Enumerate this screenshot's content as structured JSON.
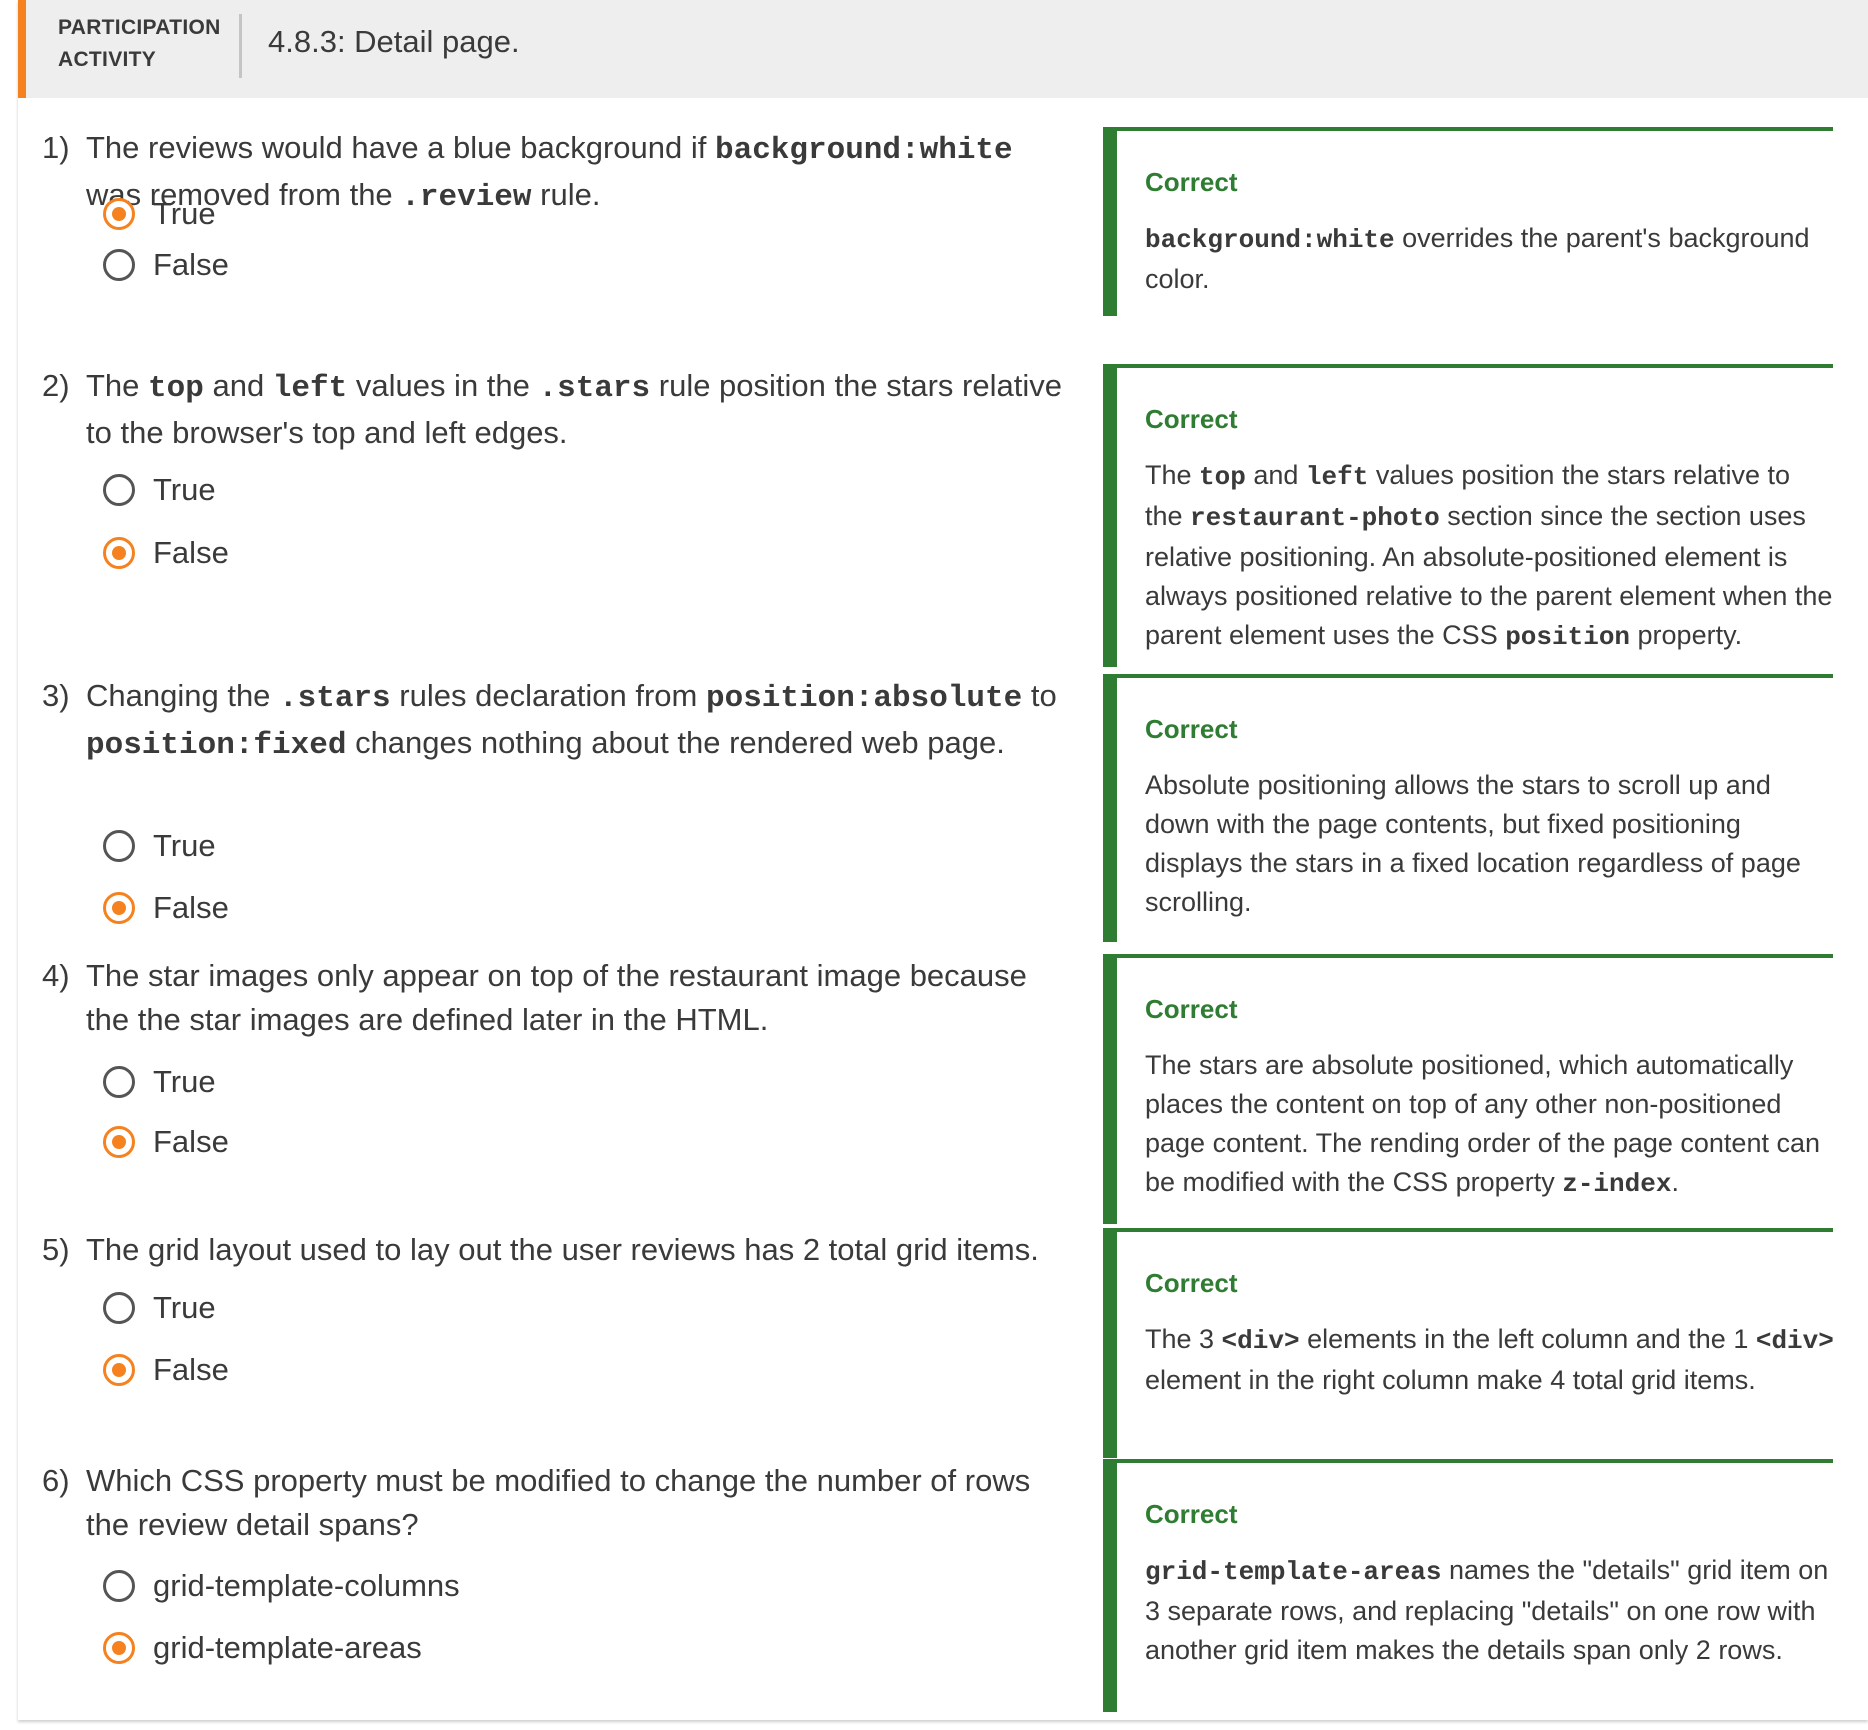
{
  "header": {
    "label_line1": "PARTICIPATION",
    "label_line2": "ACTIVITY",
    "title": "4.8.3: Detail page."
  },
  "questions": [
    {
      "number": "1)",
      "text": [
        {
          "t": "The reviews would have a blue background if "
        },
        {
          "c": "background:white"
        },
        {
          "t": " was removed from the "
        },
        {
          "c": ".review"
        },
        {
          "t": " rule."
        }
      ],
      "options": [
        {
          "label": "True",
          "selected": true
        },
        {
          "label": "False",
          "selected": false
        }
      ],
      "feedback": {
        "status": "Correct",
        "text": [
          {
            "c": "background:white"
          },
          {
            "t": " overrides the parent's background color."
          }
        ]
      }
    },
    {
      "number": "2)",
      "text": [
        {
          "t": "The "
        },
        {
          "c": "top"
        },
        {
          "t": " and "
        },
        {
          "c": "left"
        },
        {
          "t": " values in the "
        },
        {
          "c": ".stars"
        },
        {
          "t": " rule position the stars relative to the browser's top and left edges."
        }
      ],
      "options": [
        {
          "label": "True",
          "selected": false
        },
        {
          "label": "False",
          "selected": true
        }
      ],
      "feedback": {
        "status": "Correct",
        "text": [
          {
            "t": "The "
          },
          {
            "c": "top"
          },
          {
            "t": " and "
          },
          {
            "c": "left"
          },
          {
            "t": " values position the stars relative to the "
          },
          {
            "c": "restaurant-photo"
          },
          {
            "t": " section since the section uses relative positioning. An absolute-positioned element is always positioned relative to the parent element when the parent element uses the CSS "
          },
          {
            "c": "position"
          },
          {
            "t": " property."
          }
        ]
      }
    },
    {
      "number": "3)",
      "text": [
        {
          "t": "Changing the "
        },
        {
          "c": ".stars"
        },
        {
          "t": " rules declaration from "
        },
        {
          "c": "position:absolute"
        },
        {
          "t": " to "
        },
        {
          "c": "position:fixed"
        },
        {
          "t": " changes nothing about the rendered web page."
        }
      ],
      "options": [
        {
          "label": "True",
          "selected": false
        },
        {
          "label": "False",
          "selected": true
        }
      ],
      "feedback": {
        "status": "Correct",
        "text": [
          {
            "t": "Absolute positioning allows the stars to scroll up and down with the page contents, but fixed positioning displays the stars in a fixed location regardless of page scrolling."
          }
        ]
      }
    },
    {
      "number": "4)",
      "text": [
        {
          "t": "The star images only appear on top of the restaurant image because the the star images are defined later in the HTML."
        }
      ],
      "options": [
        {
          "label": "True",
          "selected": false
        },
        {
          "label": "False",
          "selected": true
        }
      ],
      "feedback": {
        "status": "Correct",
        "text": [
          {
            "t": "The stars are absolute positioned, which automatically places the content on top of any other non-positioned page content. The rending order of the page content can be modified with the CSS property "
          },
          {
            "c": "z-index"
          },
          {
            "t": "."
          }
        ]
      }
    },
    {
      "number": "5)",
      "text": [
        {
          "t": "The grid layout used to lay out the user reviews has 2 total grid items."
        }
      ],
      "options": [
        {
          "label": "True",
          "selected": false
        },
        {
          "label": "False",
          "selected": true
        }
      ],
      "feedback": {
        "status": "Correct",
        "text": [
          {
            "t": "The 3 "
          },
          {
            "c": "<div>"
          },
          {
            "t": " elements in the left column and the 1 "
          },
          {
            "c": "<div>"
          },
          {
            "t": " element in the right column make 4 total grid items."
          }
        ]
      }
    },
    {
      "number": "6)",
      "text": [
        {
          "t": "Which CSS property must be modified to change the number of rows the review detail spans?"
        }
      ],
      "options": [
        {
          "label": "grid-template-columns",
          "selected": false
        },
        {
          "label": "grid-template-areas",
          "selected": true
        }
      ],
      "feedback": {
        "status": "Correct",
        "text": [
          {
            "c": "grid-template-areas"
          },
          {
            "t": " names the \"details\" grid item on 3 separate rows, and replacing \"details\" on one row with another grid item makes the details span only 2 rows."
          }
        ]
      }
    }
  ],
  "colors": {
    "accent_orange": "#f5821f",
    "correct_green": "#2e7d32",
    "header_bg": "#eeeeee",
    "text": "#3a3a3a"
  }
}
